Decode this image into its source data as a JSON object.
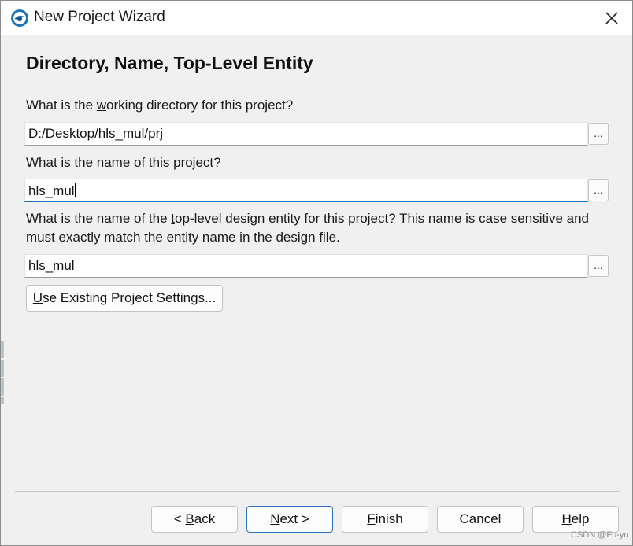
{
  "window": {
    "title": "New Project Wizard",
    "icon": "quartus-app-icon",
    "close_icon": "close-icon"
  },
  "page": {
    "heading": "Directory, Name, Top-Level Entity",
    "directory": {
      "label_before": "What is the ",
      "label_mnemonic": "w",
      "label_after": "orking directory for this project?",
      "value": "D:/Desktop/hls_mul/prj",
      "browse_label": "..."
    },
    "project_name": {
      "label_before": "What is the name of this ",
      "label_mnemonic": "p",
      "label_after": "roject?",
      "value": "hls_mul",
      "browse_label": "..."
    },
    "top_entity": {
      "label_before": "What is the name of the ",
      "label_mnemonic": "t",
      "label_after": "op-level design entity for this project? This name is case sensitive and must exactly match the entity name in the design file.",
      "value": "hls_mul",
      "browse_label": "..."
    },
    "use_existing": {
      "mnemonic": "U",
      "rest": "se Existing Project Settings..."
    }
  },
  "buttons": {
    "back": {
      "prefix": "< ",
      "mnemonic": "B",
      "rest": "ack"
    },
    "next": {
      "mnemonic": "N",
      "rest": "ext >"
    },
    "finish": {
      "mnemonic": "F",
      "rest": "inish"
    },
    "cancel": {
      "label": "Cancel"
    },
    "help": {
      "mnemonic": "H",
      "rest": "elp"
    }
  },
  "watermark": "CSDN @Fu-yu",
  "colors": {
    "focus_accent": "#1f6fbf",
    "default_button_border": "#2d6fb8",
    "background": "#f0f0f0"
  }
}
